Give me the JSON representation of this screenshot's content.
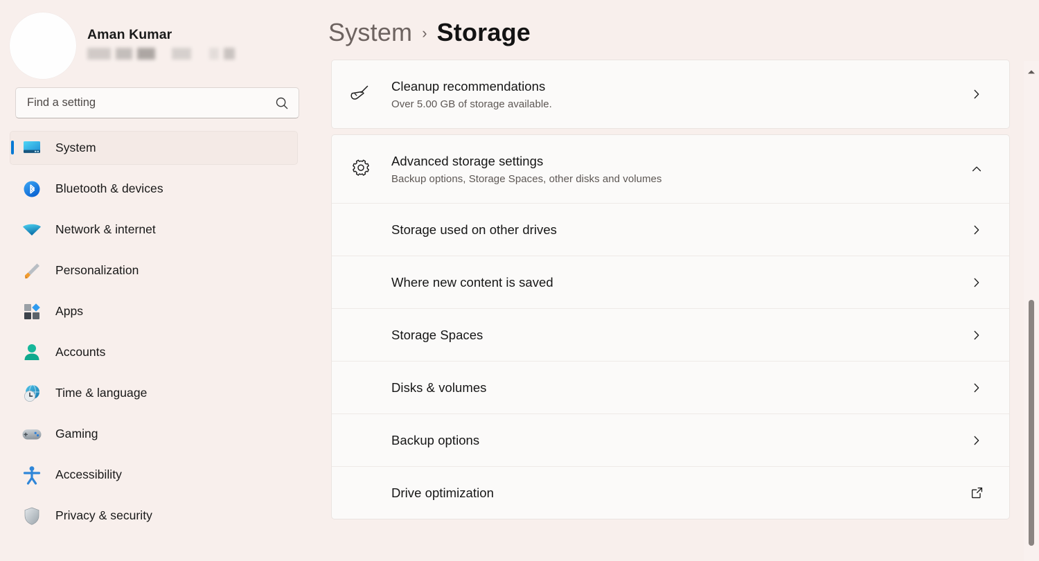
{
  "colors": {
    "page_bg": "#f8efec",
    "card_bg": "#fbfaf9",
    "accent": "#0078d4",
    "selected_bg": "#f4eae6",
    "text_primary": "#161616",
    "text_secondary": "#5d5754",
    "scrollbar_thumb": "#8a8481"
  },
  "profile": {
    "name": "Aman Kumar",
    "email_redacted": true,
    "avatar_icon": "user-avatar"
  },
  "search": {
    "placeholder": "Find a setting",
    "value": "",
    "icon": "search-icon"
  },
  "sidebar": {
    "items": [
      {
        "label": "System",
        "icon": "monitor-icon",
        "selected": true
      },
      {
        "label": "Bluetooth & devices",
        "icon": "bluetooth-icon",
        "selected": false
      },
      {
        "label": "Network & internet",
        "icon": "wifi-icon",
        "selected": false
      },
      {
        "label": "Personalization",
        "icon": "paintbrush-icon",
        "selected": false
      },
      {
        "label": "Apps",
        "icon": "apps-grid-icon",
        "selected": false
      },
      {
        "label": "Accounts",
        "icon": "person-icon",
        "selected": false
      },
      {
        "label": "Time & language",
        "icon": "clock-globe-icon",
        "selected": false
      },
      {
        "label": "Gaming",
        "icon": "gamepad-icon",
        "selected": false
      },
      {
        "label": "Accessibility",
        "icon": "accessibility-person-icon",
        "selected": false
      },
      {
        "label": "Privacy & security",
        "icon": "shield-icon",
        "selected": false
      }
    ]
  },
  "breadcrumb": {
    "parent": "System",
    "separator": "›",
    "current": "Storage"
  },
  "main": {
    "cards": [
      {
        "id": "cleanup-recommendations",
        "title": "Cleanup recommendations",
        "subtitle": "Over 5.00 GB of storage available.",
        "icon": "broom-icon",
        "action_icon": "chevron-right-icon"
      },
      {
        "id": "advanced-storage-settings",
        "title": "Advanced storage settings",
        "subtitle": "Backup options, Storage Spaces, other disks and volumes",
        "icon": "gear-icon",
        "action_icon": "chevron-up-icon",
        "expanded": true,
        "subitems": [
          {
            "label": "Storage used on other drives",
            "action_icon": "chevron-right-icon"
          },
          {
            "label": "Where new content is saved",
            "action_icon": "chevron-right-icon"
          },
          {
            "label": "Storage Spaces",
            "action_icon": "chevron-right-icon"
          },
          {
            "label": "Disks & volumes",
            "action_icon": "chevron-right-icon"
          },
          {
            "label": "Backup options",
            "action_icon": "chevron-right-icon"
          },
          {
            "label": "Drive optimization",
            "action_icon": "open-external-icon"
          }
        ]
      }
    ]
  },
  "scrollbar": {
    "up_arrow_icon": "caret-up-icon",
    "thumb_position": "lower"
  }
}
